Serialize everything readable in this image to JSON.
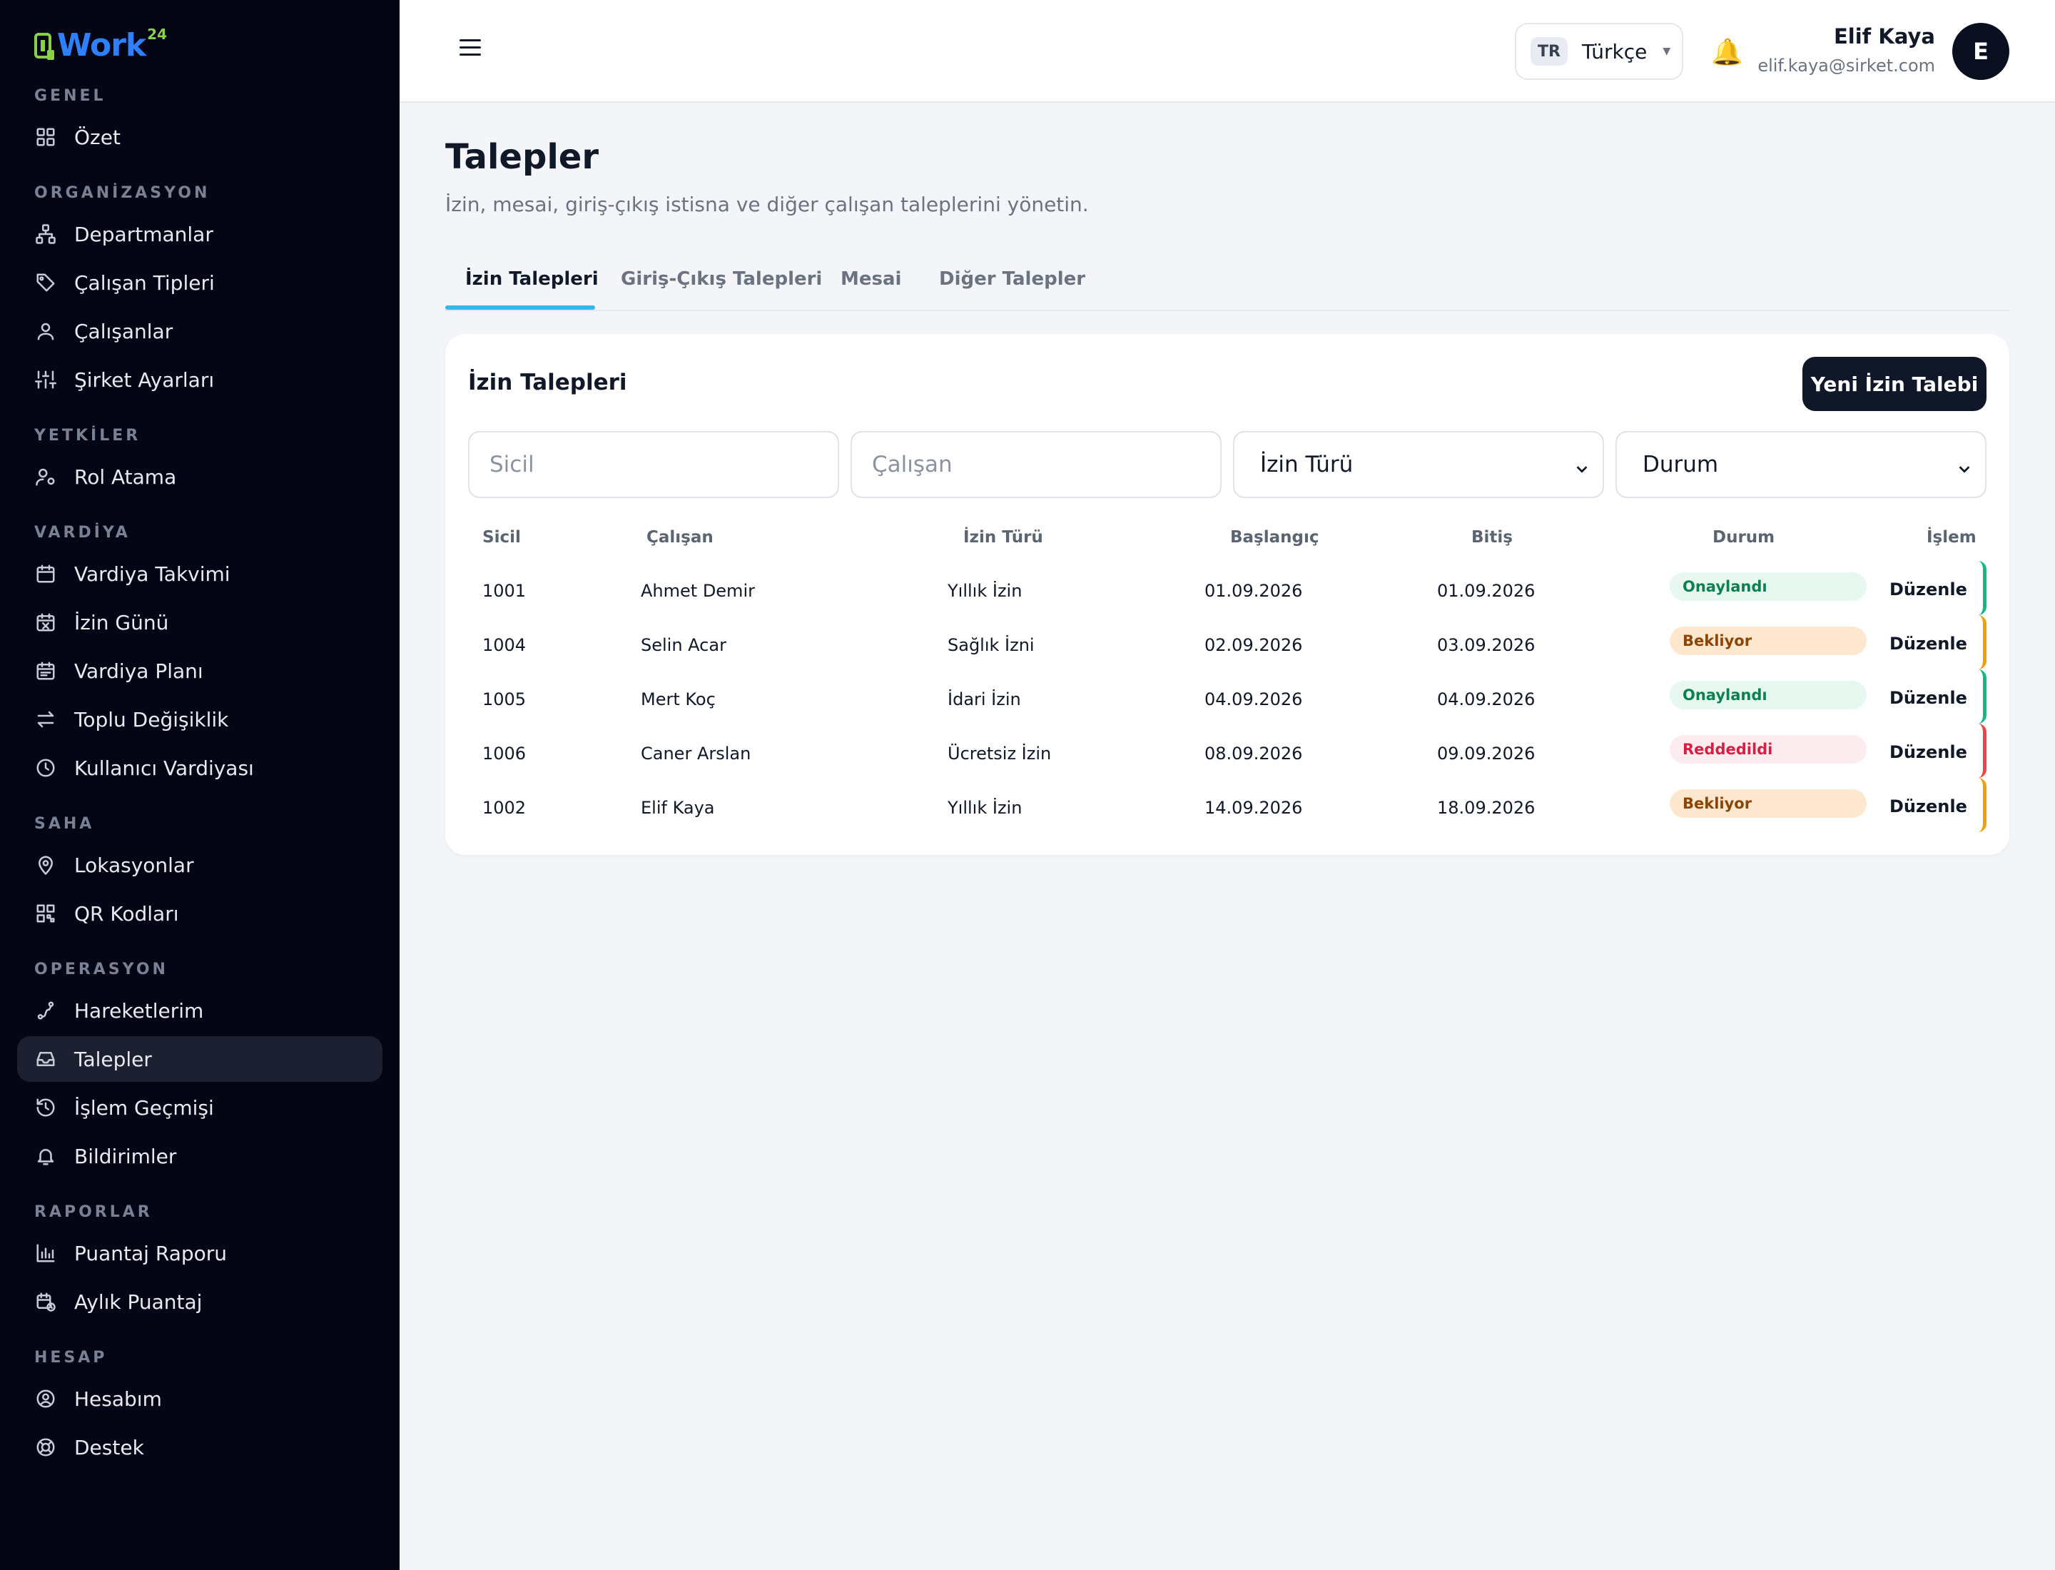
{
  "sidebar": {
    "logo": {
      "text": "Work",
      "sup": "24"
    },
    "sections": [
      {
        "title": "GENEL",
        "items": [
          {
            "label": "Özet",
            "icon": "grid-icon"
          }
        ]
      },
      {
        "title": "ORGANİZASYON",
        "items": [
          {
            "label": "Departmanlar",
            "icon": "hierarchy-icon"
          },
          {
            "label": "Çalışan Tipleri",
            "icon": "tag-icon"
          },
          {
            "label": "Çalışanlar",
            "icon": "user-icon"
          },
          {
            "label": "Şirket Ayarları",
            "icon": "sliders-icon"
          }
        ]
      },
      {
        "title": "YETKİLER",
        "items": [
          {
            "label": "Rol Atama",
            "icon": "user-gear-icon"
          }
        ]
      },
      {
        "title": "VARDİYA",
        "items": [
          {
            "label": "Vardiya Takvimi",
            "icon": "calendar-icon"
          },
          {
            "label": "İzin Günü",
            "icon": "calendar-x-icon"
          },
          {
            "label": "Vardiya Planı",
            "icon": "calendar-list-icon"
          },
          {
            "label": "Toplu Değişiklik",
            "icon": "swap-icon"
          },
          {
            "label": "Kullanıcı Vardiyası",
            "icon": "clock-icon"
          }
        ]
      },
      {
        "title": "SAHA",
        "items": [
          {
            "label": "Lokasyonlar",
            "icon": "map-pin-icon"
          },
          {
            "label": "QR Kodları",
            "icon": "qr-icon"
          }
        ]
      },
      {
        "title": "OPERASYON",
        "items": [
          {
            "label": "Hareketlerim",
            "icon": "route-icon"
          },
          {
            "label": "Talepler",
            "icon": "inbox-icon",
            "active": true
          },
          {
            "label": "İşlem Geçmişi",
            "icon": "history-icon"
          },
          {
            "label": "Bildirimler",
            "icon": "bell-icon"
          }
        ]
      },
      {
        "title": "RAPORLAR",
        "items": [
          {
            "label": "Puantaj Raporu",
            "icon": "bar-chart-icon"
          },
          {
            "label": "Aylık Puantaj",
            "icon": "calendar-clock-icon"
          }
        ]
      },
      {
        "title": "HESAP",
        "items": [
          {
            "label": "Hesabım",
            "icon": "user-circle-icon"
          },
          {
            "label": "Destek",
            "icon": "lifebuoy-icon"
          }
        ]
      }
    ]
  },
  "header": {
    "language": {
      "code": "TR",
      "name": "Türkçe"
    },
    "user": {
      "name": "Elif Kaya",
      "email": "elif.kaya@sirket.com",
      "initial": "E"
    }
  },
  "page": {
    "title": "Talepler",
    "subtitle": "İzin, mesai, giriş-çıkış istisna ve diğer çalışan taleplerini yönetin."
  },
  "tabs": [
    "İzin Talepleri",
    "Giriş-Çıkış Talepleri",
    "Mesai",
    "Diğer Talepler"
  ],
  "card": {
    "title": "İzin Talepleri",
    "new_button": "Yeni İzin Talebi",
    "filters": {
      "sicil_placeholder": "Sicil",
      "calisan_placeholder": "Çalışan",
      "izin_turu": "İzin Türü",
      "durum": "Durum"
    },
    "columns": [
      "Sicil",
      "Çalışan",
      "İzin Türü",
      "Başlangıç",
      "Bitiş",
      "Durum",
      "İşlem"
    ],
    "rows": [
      {
        "sicil": "1001",
        "calisan": "Ahmet Demir",
        "tur": "Yıllık İzin",
        "baslangic": "01.09.2026",
        "bitis": "01.09.2026",
        "durum": "Onaylandı",
        "islem": "Düzenle"
      },
      {
        "sicil": "1004",
        "calisan": "Selin Acar",
        "tur": "Sağlık İzni",
        "baslangic": "02.09.2026",
        "bitis": "03.09.2026",
        "durum": "Bekliyor",
        "islem": "Düzenle"
      },
      {
        "sicil": "1005",
        "calisan": "Mert Koç",
        "tur": "İdari İzin",
        "baslangic": "04.09.2026",
        "bitis": "04.09.2026",
        "durum": "Onaylandı",
        "islem": "Düzenle"
      },
      {
        "sicil": "1006",
        "calisan": "Caner Arslan",
        "tur": "Ücretsiz İzin",
        "baslangic": "08.09.2026",
        "bitis": "09.09.2026",
        "durum": "Reddedildi",
        "islem": "Düzenle"
      },
      {
        "sicil": "1002",
        "calisan": "Elif Kaya",
        "tur": "Yıllık İzin",
        "baslangic": "14.09.2026",
        "bitis": "18.09.2026",
        "durum": "Bekliyor",
        "islem": "Düzenle"
      }
    ]
  },
  "colors": {
    "approved": "#10b981",
    "pending": "#f59e0b",
    "rejected": "#ef4444",
    "accent": "#38b6e8"
  }
}
